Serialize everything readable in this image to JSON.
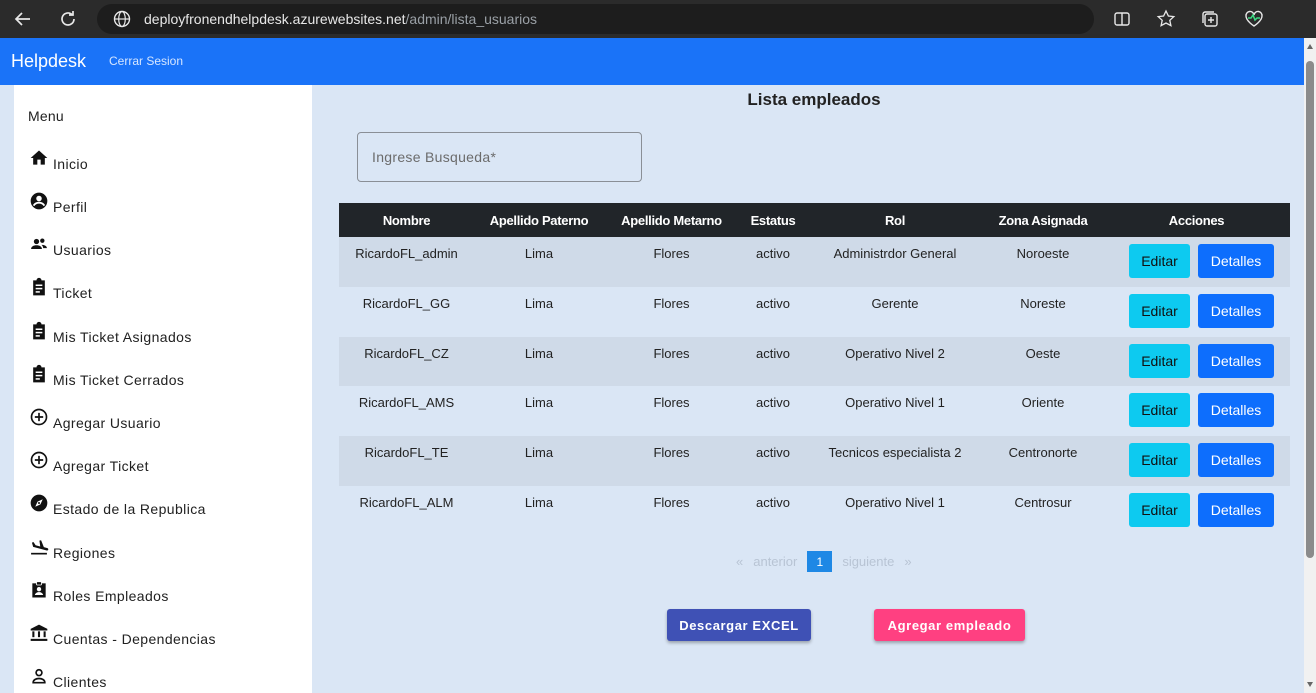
{
  "browser": {
    "url_host": "deployfronendhelpdesk.azurewebsites.net",
    "url_path": "/admin/lista_usuarios"
  },
  "topbar": {
    "brand": "Helpdesk",
    "logout": "Cerrar Sesion",
    "color": "#1a73f8"
  },
  "sidebar": {
    "title": "Menu",
    "items": [
      {
        "label": "Inicio",
        "icon": "home-icon"
      },
      {
        "label": "Perfil",
        "icon": "account-circle-icon"
      },
      {
        "label": "Usuarios",
        "icon": "people-icon"
      },
      {
        "label": "Ticket",
        "icon": "clipboard-icon"
      },
      {
        "label": "Mis Ticket Asignados",
        "icon": "clipboard-icon"
      },
      {
        "label": "Mis Ticket Cerrados",
        "icon": "clipboard-icon"
      },
      {
        "label": "Agregar Usuario",
        "icon": "add-circle-icon"
      },
      {
        "label": "Agregar Ticket",
        "icon": "add-circle-icon"
      },
      {
        "label": "Estado de la Republica",
        "icon": "compass-icon"
      },
      {
        "label": "Regiones",
        "icon": "flight-land-icon"
      },
      {
        "label": "Roles Empleados",
        "icon": "badge-icon"
      },
      {
        "label": "Cuentas - Dependencias",
        "icon": "bank-icon"
      },
      {
        "label": "Clientes",
        "icon": "person-icon"
      }
    ]
  },
  "main": {
    "title": "Lista empleados",
    "search_placeholder": "Ingrese Busqueda*",
    "columns": [
      "Nombre",
      "Apellido Paterno",
      "Apellido Metarno",
      "Estatus",
      "Rol",
      "Zona Asignada",
      "Acciones"
    ],
    "rows": [
      [
        "RicardoFL_admin",
        "Lima",
        "Flores",
        "activo",
        "Administrdor General",
        "Noroeste"
      ],
      [
        "RicardoFL_GG",
        "Lima",
        "Flores",
        "activo",
        "Gerente",
        "Noreste"
      ],
      [
        "RicardoFL_CZ",
        "Lima",
        "Flores",
        "activo",
        "Operativo Nivel 2",
        "Oeste"
      ],
      [
        "RicardoFL_AMS",
        "Lima",
        "Flores",
        "activo",
        "Operativo Nivel 1",
        "Oriente"
      ],
      [
        "RicardoFL_TE",
        "Lima",
        "Flores",
        "activo",
        "Tecnicos especialista 2",
        "Centronorte"
      ],
      [
        "RicardoFL_ALM",
        "Lima",
        "Flores",
        "activo",
        "Operativo Nivel 1",
        "Centrosur"
      ]
    ],
    "edit_label": "Editar",
    "details_label": "Detalles",
    "pager": {
      "first": "«",
      "prev": "anterior",
      "current": "1",
      "next": "siguiente",
      "last": "»"
    },
    "excel_label": "Descargar EXCEL",
    "add_label": "Agregar empleado"
  }
}
